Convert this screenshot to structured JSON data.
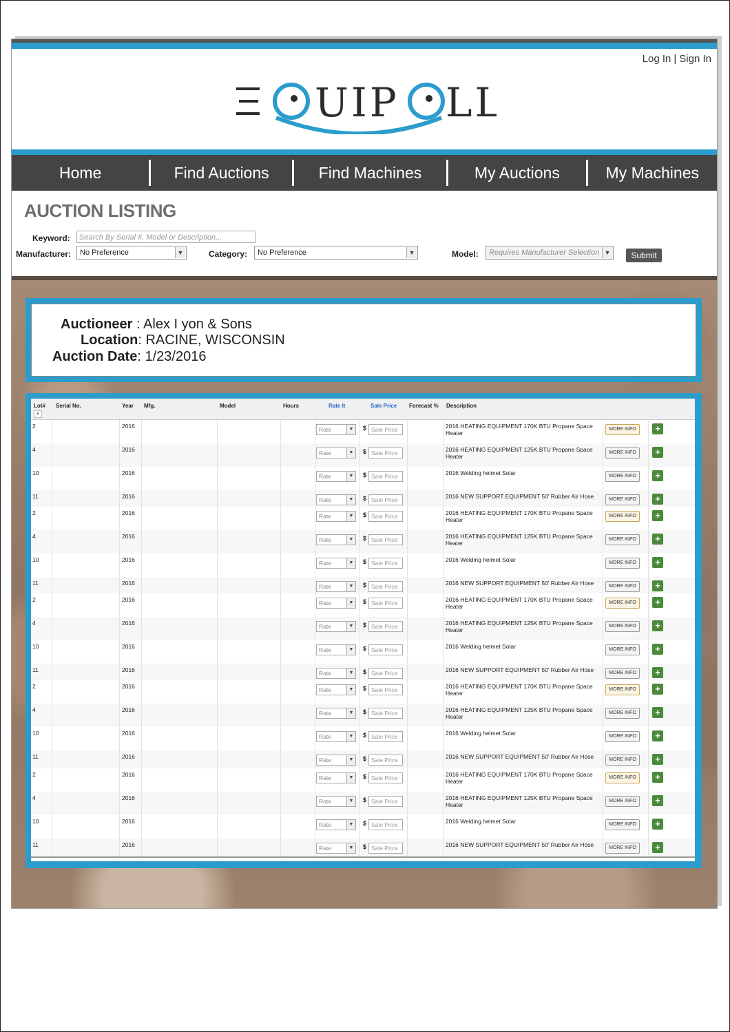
{
  "auth": {
    "login": "Log In",
    "signin": "Sign In"
  },
  "brand": {
    "logo_text": "EQUIPOLL",
    "colors": {
      "accent": "#2b9ccc",
      "nav": "#444444",
      "add": "#4a8a3a"
    }
  },
  "nav": {
    "items": [
      "Home",
      "Find Auctions",
      "Find Machines",
      "My Auctions",
      "My Machines"
    ]
  },
  "listing": {
    "title": "AUCTION LISTING",
    "keyword_label": "Keyword:",
    "keyword_placeholder": "Search By Serial #, Model or Description...",
    "manufacturer_label": "Manufacturer:",
    "manufacturer_value": "No Preference",
    "category_label": "Category:",
    "category_value": "No Preference",
    "model_label": "Model:",
    "model_value": "Requires Manufacturer Selection",
    "submit": "Submit"
  },
  "auction": {
    "auctioneer_label": "Auctioneer",
    "auctioneer": "Alex I yon & Sons",
    "location_label": "Location",
    "location": "RACINE, WISCONSIN",
    "date_label": "Auction Date",
    "date": "1/23/2016"
  },
  "table": {
    "headers": [
      "Lot#",
      "Serial No.",
      "Year",
      "Mfg.",
      "Model",
      "Hours",
      "Rate It",
      "Sale Price",
      "Forecast %",
      "Description"
    ],
    "rate_placeholder": "Rate",
    "price_placeholder": "Sale Price",
    "more_label": "MORE INFO",
    "plus_label": "+",
    "rows": [
      {
        "lot": "2",
        "year": "2016",
        "desc": "2016 HEATING EQUIPMENT 170K BTU Propane Space Heater"
      },
      {
        "lot": "4",
        "year": "2016",
        "desc": "2016 HEATING EQUIPMENT 125K BTU Propane Space Heater"
      },
      {
        "lot": "10",
        "year": "2016",
        "desc": "2016 Welding helmet Solar"
      },
      {
        "lot": "11",
        "year": "2016",
        "desc": "2016 NEW SUPPORT EQUIPMENT 50' Rubber Air Hose"
      },
      {
        "lot": "2",
        "year": "2016",
        "desc": "2016 HEATING EQUIPMENT 170K BTU Propane Space Heater"
      },
      {
        "lot": "4",
        "year": "2016",
        "desc": "2016 HEATING EQUIPMENT 125K BTU Propane Space Heater"
      },
      {
        "lot": "10",
        "year": "2016",
        "desc": "2016 Welding helmet Solar"
      },
      {
        "lot": "11",
        "year": "2016",
        "desc": "2016 NEW SUPPORT EQUIPMENT 50' Rubber Air Hose"
      },
      {
        "lot": "2",
        "year": "2016",
        "desc": "2016 HEATING EQUIPMENT 170K BTU Propane Space Heater"
      },
      {
        "lot": "4",
        "year": "2016",
        "desc": "2016 HEATING EQUIPMENT 125K BTU Propane Space Heater"
      },
      {
        "lot": "10",
        "year": "2016",
        "desc": "2016 Welding helmet Solar"
      },
      {
        "lot": "11",
        "year": "2016",
        "desc": "2016 NEW SUPPORT EQUIPMENT 50' Rubber Air Hose"
      },
      {
        "lot": "2",
        "year": "2016",
        "desc": "2016 HEATING EQUIPMENT 170K BTU Propane Space Heater"
      },
      {
        "lot": "4",
        "year": "2016",
        "desc": "2016 HEATING EQUIPMENT 125K BTU Propane Space Heater"
      },
      {
        "lot": "10",
        "year": "2016",
        "desc": "2016 Welding helmet Solar"
      },
      {
        "lot": "11",
        "year": "2016",
        "desc": "2016 NEW SUPPORT EQUIPMENT 50' Rubber Air Hose"
      },
      {
        "lot": "2",
        "year": "2016",
        "desc": "2016 HEATING EQUIPMENT 170K BTU Propane Space Heater"
      },
      {
        "lot": "4",
        "year": "2016",
        "desc": "2016 HEATING EQUIPMENT 125K BTU Propane Space Heater"
      },
      {
        "lot": "10",
        "year": "2016",
        "desc": "2016 Welding helmet Solar"
      },
      {
        "lot": "11",
        "year": "2016",
        "desc": "2016 NEW SUPPORT EQUIPMENT 50' Rubber Air Hose"
      }
    ]
  }
}
